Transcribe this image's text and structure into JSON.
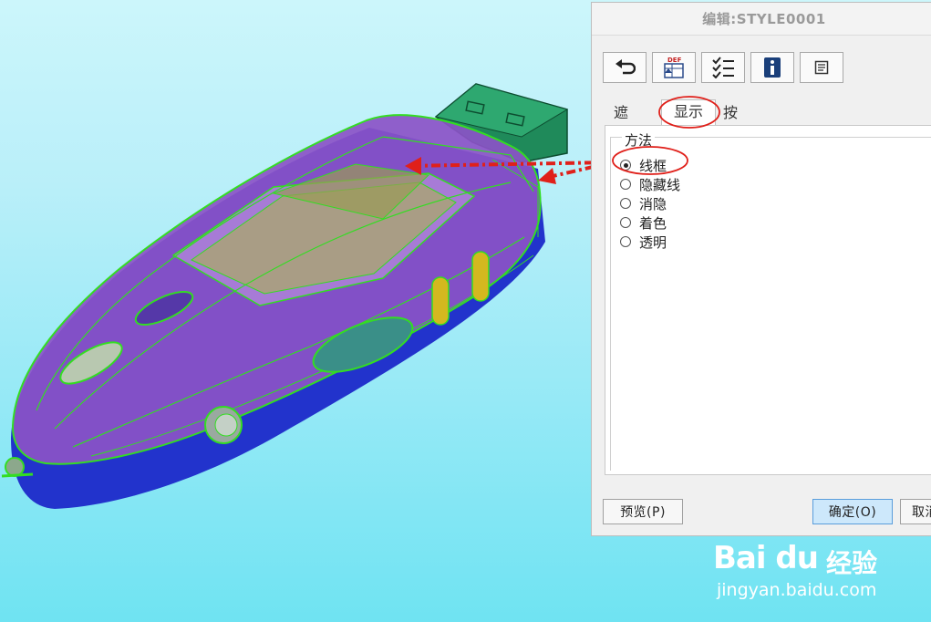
{
  "dialog": {
    "title": "编辑:STYLE0001",
    "toolbar": [
      {
        "icon": "undo-icon"
      },
      {
        "icon": "def-layer-icon",
        "text": "DEF"
      },
      {
        "icon": "checklist-icon"
      },
      {
        "icon": "info-icon"
      },
      {
        "icon": "properties-icon"
      }
    ],
    "tabs": [
      {
        "label": "遮蔽",
        "active": false
      },
      {
        "label": "显示",
        "active": true
      },
      {
        "label": "按显示",
        "active": false
      }
    ],
    "method_group": {
      "title": "方法",
      "options": [
        {
          "label": "线框",
          "selected": true
        },
        {
          "label": "隐藏线",
          "selected": false
        },
        {
          "label": "消隐",
          "selected": false
        },
        {
          "label": "着色",
          "selected": false
        },
        {
          "label": "透明",
          "selected": false
        }
      ]
    },
    "buttons": {
      "preview": "预览(P)",
      "ok": "确定(O)",
      "cancel": "取消"
    }
  },
  "watermark": {
    "brand": "Bai du",
    "product": "经验",
    "url": "jingyan.baidu.com"
  },
  "colors": {
    "background": "#b9eff9",
    "model_body": "#8b52c7",
    "model_base": "#2233cc",
    "wireframe": "#33dd22",
    "connector": "#1f8a5a",
    "annotation_red": "#e0201a",
    "ok_button": "#cde8fb"
  }
}
